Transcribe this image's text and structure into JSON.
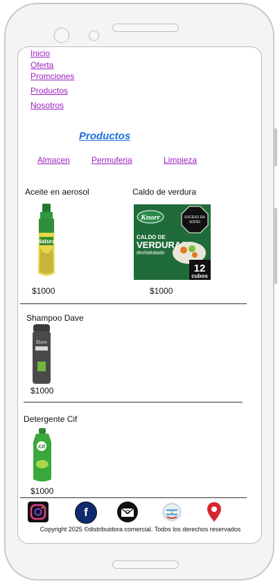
{
  "nav": {
    "items": [
      {
        "label": "Inicio"
      },
      {
        "label": "Oferta"
      },
      {
        "label": "Promciones"
      },
      {
        "label": "Productos"
      },
      {
        "label": "Nosotros"
      }
    ]
  },
  "page_title": "Productos",
  "categories": [
    {
      "label": "Almacen"
    },
    {
      "label": "Permuferia"
    },
    {
      "label": "Limpieza"
    }
  ],
  "products": [
    {
      "name": "Aceite en aerosol",
      "price": "$1000",
      "brand": "Natura"
    },
    {
      "name": "Caldo de verdura",
      "price": "$1000",
      "brand": "Knorr",
      "pack_title": "CALDO DE",
      "pack_title2": "VERDURAS",
      "pack_sub": "deshidratado",
      "pack_count": "12",
      "pack_unit": "cubos",
      "pack_badge1": "EXCESO EN",
      "pack_badge2": "SODIO"
    },
    {
      "name": "Shampoo Dave",
      "price": "$1000",
      "brand": "Dove"
    },
    {
      "name": "Detergente Cif",
      "price": "$1000",
      "brand": "Cif"
    }
  ],
  "footer": {
    "icons": [
      "instagram-icon",
      "facebook-icon",
      "email-icon",
      "flag-icon",
      "location-pin-icon"
    ],
    "copyright": "Copyright 2025 ©distribuidora comercial. Todos los derechos reservados"
  },
  "colors": {
    "link": "#9b1fbf",
    "title": "#1b6fd9"
  }
}
